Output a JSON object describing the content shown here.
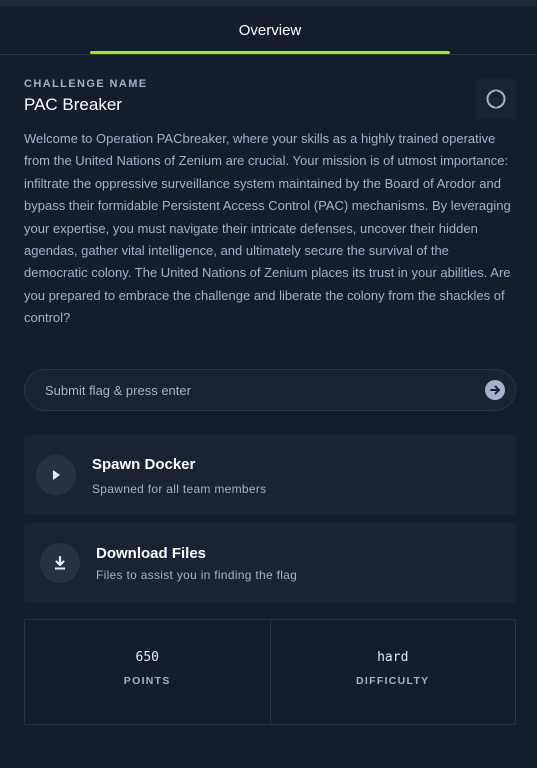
{
  "tabs": [
    {
      "label": "Overview",
      "active": true
    }
  ],
  "challenge": {
    "caption": "CHALLENGE NAME",
    "name": "PAC Breaker",
    "category_icon": "brain-icon",
    "description": "Welcome to Operation PACbreaker, where your skills as a highly trained operative from the United Nations of Zenium are crucial. Your mission is of utmost importance: infiltrate the oppressive surveillance system maintained by the Board of Arodor and bypass their formidable Persistent Access Control (PAC) mechanisms. By leveraging your expertise, you must navigate their intricate defenses, uncover their hidden agendas, gather vital intelligence, and ultimately secure the survival of the democratic colony. The United Nations of Zenium places its trust in your abilities. Are you prepared to embrace the challenge and liberate the colony from the shackles of control?"
  },
  "flag_input": {
    "value": "",
    "placeholder": "Submit flag & press enter",
    "submit_icon": "arrow-right-circle-icon"
  },
  "actions": {
    "spawn": {
      "title": "Spawn Docker",
      "subtitle": "Spawned for all team members",
      "icon": "play-icon"
    },
    "download": {
      "title": "Download Files",
      "subtitle": "Files to assist you in finding the flag",
      "icon": "download-icon"
    }
  },
  "stats": {
    "points": {
      "value": "650",
      "label": "POINTS"
    },
    "difficulty": {
      "value": "hard",
      "label": "DIFFICULTY"
    }
  },
  "colors": {
    "background": "#141d2b",
    "panel": "#1a2332",
    "accent": "#9fef00",
    "text": "#a4b1cd",
    "heading": "#ffffff"
  }
}
